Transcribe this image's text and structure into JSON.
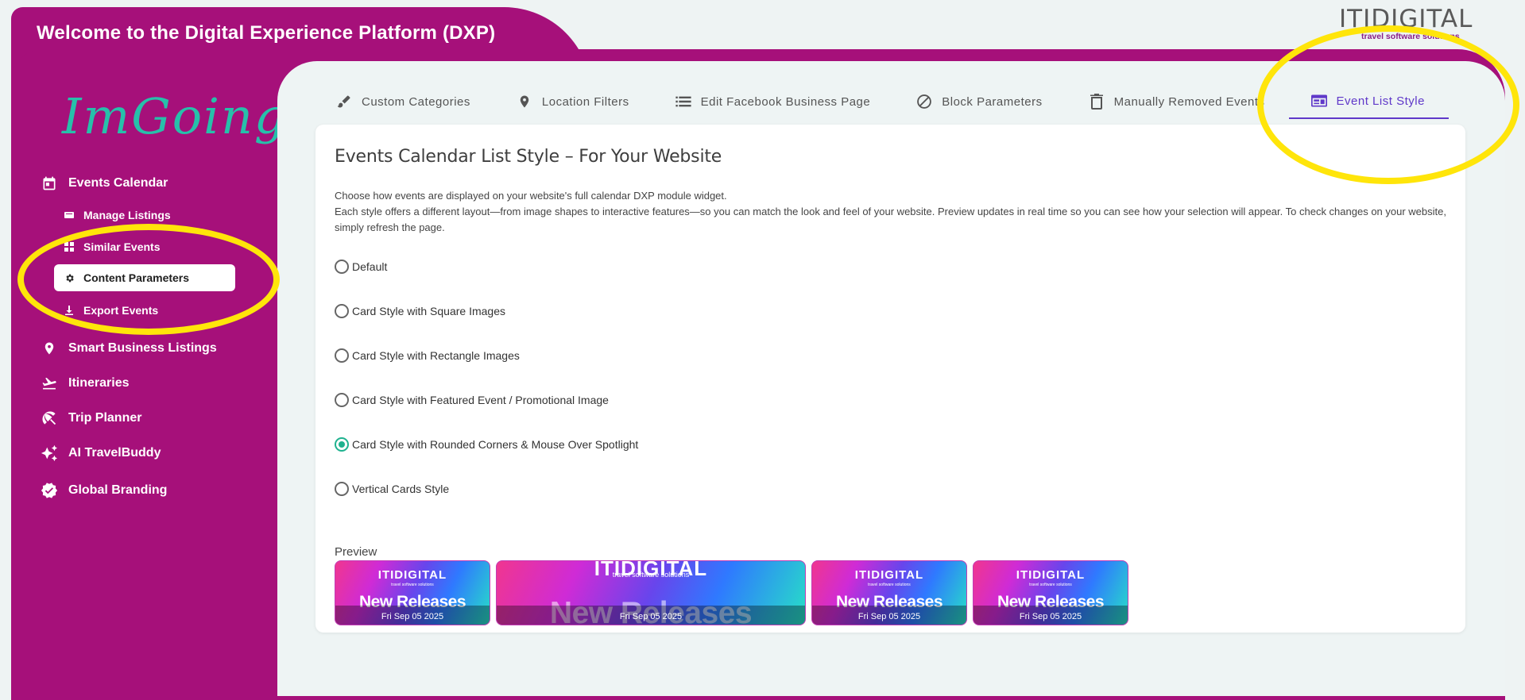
{
  "header": {
    "app_title": "Welcome to the Digital Experience Platform (DXP)",
    "logo_brand": "ITIDIGITAL",
    "logo_tagline": "travel software solutions"
  },
  "sidebar": {
    "brand": "ImGoing",
    "events_calendar": "Events Calendar",
    "sub_items": [
      {
        "label": "Manage Listings",
        "icon": "list-icon"
      },
      {
        "label": "Similar Events",
        "icon": "grid-icon"
      },
      {
        "label": "Content Parameters",
        "icon": "gear-icon",
        "active": true
      },
      {
        "label": "Export Events",
        "icon": "download-icon"
      }
    ],
    "items": [
      {
        "label": "Smart Business Listings",
        "icon": "location-pin-icon"
      },
      {
        "label": "Itineraries",
        "icon": "plane-departure-icon"
      },
      {
        "label": "Trip Planner",
        "icon": "beach-umbrella-icon"
      },
      {
        "label": "AI TravelBuddy",
        "icon": "sparkles-icon"
      },
      {
        "label": "Global Branding",
        "icon": "verified-badge-icon"
      }
    ]
  },
  "tabs": [
    {
      "label": "Custom Categories",
      "icon": "brush-icon"
    },
    {
      "label": "Location Filters",
      "icon": "location-pin-icon"
    },
    {
      "label": "Edit Facebook Business Page",
      "icon": "list-icon"
    },
    {
      "label": "Block Parameters",
      "icon": "block-icon"
    },
    {
      "label": "Manually Removed Events",
      "icon": "trash-icon"
    },
    {
      "label": "Event List Style",
      "icon": "web-layout-icon",
      "active": true
    }
  ],
  "content": {
    "title": "Events Calendar List Style – For Your Website",
    "description_line1": "Choose how events are displayed on your website's full calendar DXP module widget.",
    "description_line2": "Each style offers a different layout—from image shapes to interactive features—so you can match the look and feel of your website. Preview updates in real time so you can see how your selection will appear. To check changes on your website, simply refresh the page.",
    "options": [
      {
        "label": "Default",
        "selected": false
      },
      {
        "label": "Card Style with Square Images",
        "selected": false
      },
      {
        "label": "Card Style with Rectangle Images",
        "selected": false
      },
      {
        "label": "Card Style with Featured Event / Promotional Image",
        "selected": false
      },
      {
        "label": "Card Style with Rounded Corners & Mouse Over Spotlight",
        "selected": true
      },
      {
        "label": "Vertical Cards Style",
        "selected": false
      }
    ],
    "preview_label": "Preview",
    "preview_cards": [
      {
        "brand": "ITIDIGITAL",
        "tagline": "travel software solutions",
        "title": "New Releases",
        "date": "Fri Sep 05 2025"
      },
      {
        "brand": "ITIDIGITAL",
        "tagline": "travel software solutions",
        "title": "New Releases",
        "date": "Fri Sep 05 2025"
      },
      {
        "brand": "ITIDIGITAL",
        "tagline": "travel software solutions",
        "title": "New Releases",
        "date": "Fri Sep 05 2025"
      },
      {
        "brand": "ITIDIGITAL",
        "tagline": "travel software solutions",
        "title": "New Releases",
        "date": "Fri Sep 05 2025"
      }
    ]
  },
  "colors": {
    "brand_magenta": "#a6107a",
    "accent_purple": "#5f38c9",
    "radio_green": "#1fb28f",
    "highlight_yellow": "#ffe50a",
    "script_teal": "#27c0aa"
  }
}
